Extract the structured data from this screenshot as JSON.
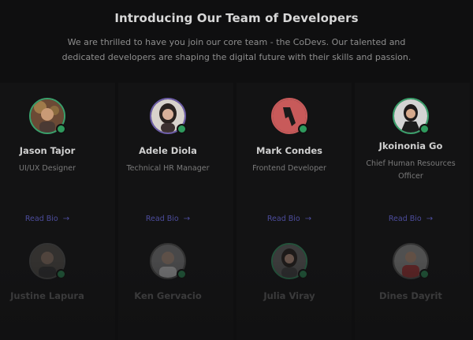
{
  "header": {
    "title": "Introducing Our Team of Developers",
    "subtitle_line1": "We are thrilled to have you join our core team - the CoDevs. Our talented and",
    "subtitle_line2": "dedicated developers are shaping the digital future with their skills and passion."
  },
  "team": [
    {
      "name": "Jason Tajor",
      "role": "UI/UX Designer",
      "role2": "",
      "link": "Read Bio",
      "avatar_icon": "person-photo-icon"
    },
    {
      "name": "Adele Diola",
      "role": "Technical HR Manager",
      "role2": "",
      "link": "Read Bio",
      "avatar_icon": "person-photo-icon"
    },
    {
      "name": "Mark Condes",
      "role": "Frontend Developer",
      "role2": "",
      "link": "Read Bio",
      "avatar_icon": "logo-icon"
    },
    {
      "name": "Jkoinonia Go",
      "role": "Chief Human Resources",
      "role2": "Officer",
      "link": "Read Bio",
      "avatar_icon": "person-photo-icon"
    },
    {
      "name": "Justine Lapura"
    },
    {
      "name": "Ken Gervacio"
    },
    {
      "name": "Julia Viray"
    },
    {
      "name": "Dines Dayrit"
    }
  ],
  "colors": {
    "background": "#0f0f10",
    "status_online": "#2e9a5d",
    "link": "#4c4c9c",
    "logo_bg": "#c85a5a"
  }
}
